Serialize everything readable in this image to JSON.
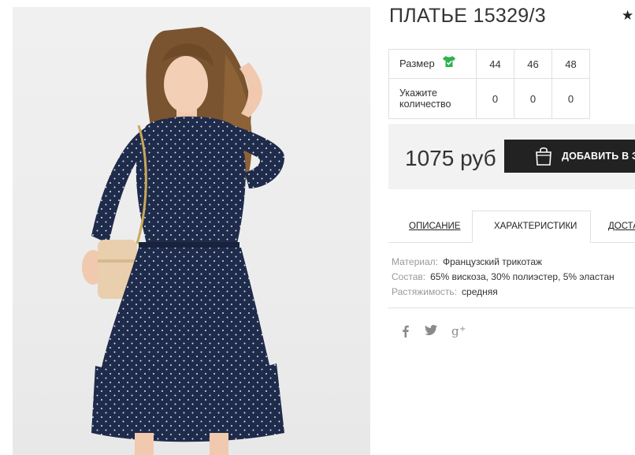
{
  "product": {
    "title": "ПЛАТЬЕ 15329/3",
    "rating_glyph": "★"
  },
  "size_table": {
    "size_label": "Размер",
    "size_icon": "tshirt-check-icon",
    "sizes": [
      "44",
      "46",
      "48"
    ],
    "quantity_label": "Укажите количество",
    "quantity_label_line1": "Укажите",
    "quantity_label_line2": "количество",
    "quantities": [
      "0",
      "0",
      "0"
    ]
  },
  "purchase": {
    "price": "1075 руб",
    "add_button_label": "ДОБАВИТЬ В ЗАКАЗ",
    "button_icon": "shopping-bag-icon"
  },
  "tabs": {
    "description": "ОПИСАНИЕ",
    "characteristics": "ХАРАКТЕРИСТИКИ",
    "delivery": "ДОСТАВКА",
    "active": "characteristics"
  },
  "specs": [
    {
      "key": "Материал:",
      "value": "Французский трикотаж"
    },
    {
      "key": "Состав:",
      "value": "65% вискоза, 30% полиэстер, 5% эластан"
    },
    {
      "key": "Растяжимость:",
      "value": "средняя"
    }
  ],
  "social": {
    "facebook": "f",
    "twitter_icon": "twitter-icon",
    "googleplus": "g+"
  },
  "colors": {
    "button_bg": "#222222",
    "price_bar_bg": "#f2f2f2",
    "size_icon_green": "#2bb24c",
    "dress_navy": "#1f2b4a"
  }
}
